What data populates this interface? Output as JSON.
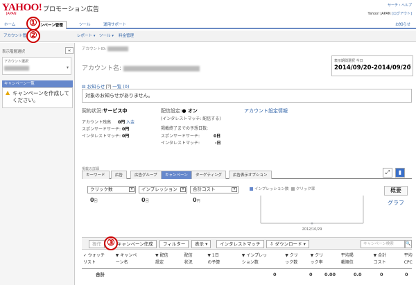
{
  "header": {
    "logo": "YAHOO!",
    "logo_sub": "JAPAN",
    "brand": "プロモーション広告",
    "top_links": "サーチ・ヘルプ",
    "top_user": "Yahoo! JAPAN",
    "top_user_link": "[ログアウト]"
  },
  "tabs": [
    {
      "label": "ホーム"
    },
    {
      "label": "キャンペーン管理"
    },
    {
      "label": "ツール"
    },
    {
      "label": "運用サポート"
    }
  ],
  "tabs_right": "お知らせ",
  "subnav": [
    {
      "label": "アカウント管理"
    },
    {
      "label": "レポート ▾"
    },
    {
      "label": "ツール ▾"
    },
    {
      "label": "料金管理"
    }
  ],
  "markers": [
    "①",
    "②",
    "③"
  ],
  "left_panel": {
    "label": "表示階層選択",
    "collapse": "«",
    "account_label": "アカウント選択",
    "account_arrow": "▾",
    "campaign_header": "キャンペーン一覧",
    "warn_icon": "▲",
    "campaign_msg": "キャンペーンを作成してください。"
  },
  "account": {
    "id_label": "アカウントID:",
    "name_label": "アカウント名:"
  },
  "date": {
    "label": "表示期間選択 今日",
    "range": "2014/09/20-2014/09/20",
    "dd": "▾"
  },
  "notice": {
    "title": "お知らせ",
    "count": "一覧 (0)",
    "message": "対象のお知らせがありません。"
  },
  "status": {
    "contract_label": "契約状況:",
    "contract_value": "サービス中",
    "account_bal_label": "アカウント残高",
    "account_bal_value": "0円",
    "deposit_link": "入金",
    "sponsored_label": "スポンサードサーチ:",
    "sponsored_value": "0円",
    "interest_label": "インタレストマッチ:",
    "interest_value": "0円",
    "delivery_label": "配信設定:",
    "delivery_value": "● オン",
    "interest_note": "(インタレストマッチ: 配信する)",
    "est_label": "掲載終了までの予想日数:",
    "est_sponsored_label": "スポンサードサーチ:",
    "est_sponsored_value": "0日",
    "est_interest_label": "インタレストマッチ:",
    "est_interest_value": "-日",
    "settings_link": "アカウント設定情報"
  },
  "performance": {
    "title": "掲載の詳細",
    "tabs": [
      {
        "label": "キーワード"
      },
      {
        "label": "広告"
      },
      {
        "label": "広告グループ"
      },
      {
        "label": "キャンペーン"
      },
      {
        "label": "ターゲティング"
      },
      {
        "label": "広告表示オプション"
      }
    ],
    "metrics": [
      {
        "label": "クリック数",
        "value": "0",
        "unit": "回"
      },
      {
        "label": "インプレッション",
        "value": "0",
        "unit": "回"
      },
      {
        "label": "合計コスト",
        "value": "0",
        "unit": "円"
      }
    ],
    "overview": "概要",
    "graph": "グラフ"
  },
  "chart_data": {
    "type": "line",
    "series": [
      {
        "name": "インプレッション数",
        "values": [
          0
        ]
      },
      {
        "name": "クリック率",
        "values": [
          0
        ]
      }
    ],
    "x": [
      "2012/10/29"
    ],
    "ylim": [
      0,
      1
    ],
    "colors": [
      "#6688cc",
      "#aaaaaa"
    ]
  },
  "toolbar": {
    "edit": "操作",
    "create": "キャンペーン作成",
    "filter": "フィルター",
    "display": "表示 ▾",
    "interest": "インタレストマッチ",
    "download": "⇩ ダウンロード ▾",
    "search_placeholder": "キャンペーン検索",
    "search_icon": "🔍"
  },
  "table": {
    "headers": [
      {
        "l1": "✓ ウォッチ",
        "l2": "リスト"
      },
      {
        "l1": "▼ キャンペ",
        "l2": "ーン名"
      },
      {
        "l1": "▼ 配信",
        "l2": "設定"
      },
      {
        "l1": "配信",
        "l2": "状況"
      },
      {
        "l1": "▼ 1日",
        "l2": "の予算"
      },
      {
        "l1": "▼ インプレッ",
        "l2": "ション数"
      },
      {
        "l1": "▼ クリ",
        "l2": "ック数"
      },
      {
        "l1": "▼ クリ",
        "l2": "ック率"
      },
      {
        "l1": "平均掲",
        "l2": "載順位"
      },
      {
        "l1": "▼ 合計",
        "l2": "コスト"
      },
      {
        "l1": "平均",
        "l2": "CPC"
      }
    ],
    "total": {
      "label": "合計",
      "impressions": "0",
      "clicks": "0",
      "ctr": "0.00",
      "avg_pos": "0.0",
      "cost": "0",
      "cpc": "0"
    }
  }
}
